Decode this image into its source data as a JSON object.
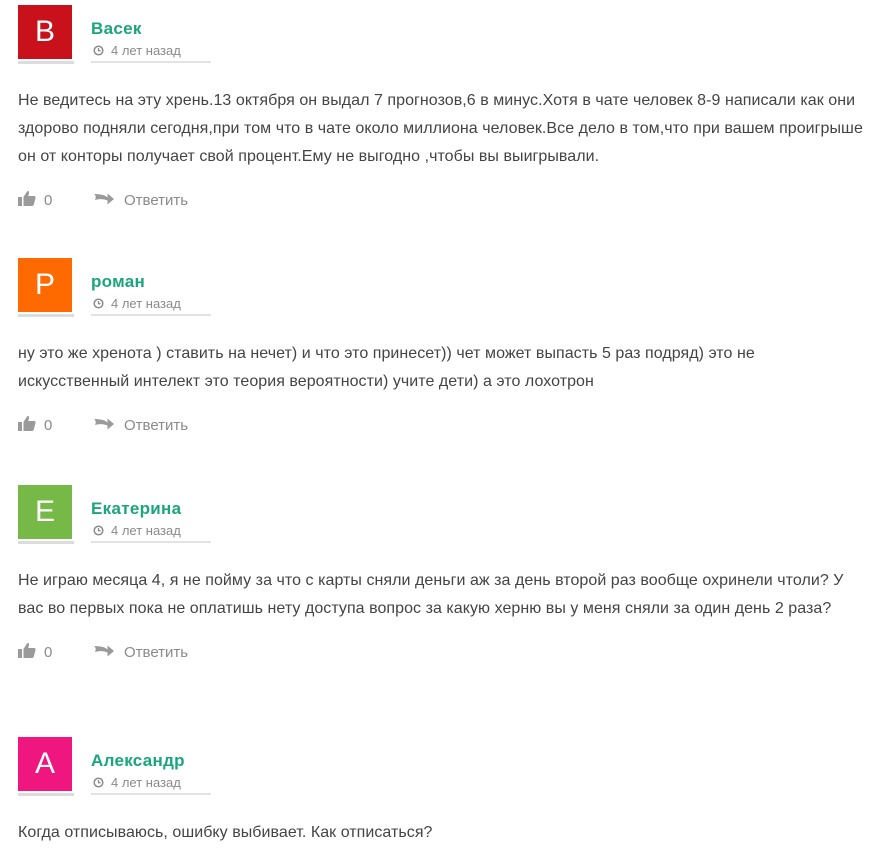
{
  "comments": [
    {
      "avatar_letter": "В",
      "avatar_color": "#c8111b",
      "author": "Васек",
      "time": "4 лет назад",
      "text": "Не ведитесь на эту хрень.13 октября он выдал 7 прогнозов,6 в минус.Хотя в чате человек 8-9 написали как они здорово подняли сегодня,при том что в чате около миллиона человек.Все дело в том,что при вашем проигрыше он от конторы получает свой процент.Ему не выгодно ,чтобы вы выигрывали.",
      "likes": "0",
      "reply_label": "Ответить"
    },
    {
      "avatar_letter": "Р",
      "avatar_color": "#ff6a00",
      "author": "роман",
      "time": "4 лет назад",
      "text": "ну это же хренота ) ставить на нечет) и что это принесет)) чет может выпасть 5 раз подряд) это не искусственный интелект это теория вероятности) учите дети) а это лохотрон",
      "likes": "0",
      "reply_label": "Ответить"
    },
    {
      "avatar_letter": "Е",
      "avatar_color": "#76b947",
      "author": "Екатерина",
      "time": "4 лет назад",
      "text": "Не играю месяца 4, я не пойму за что с карты сняли деньги аж за день второй раз вообще охринели чтоли? У вас во первых пока не оплатишь нету доступа вопрос за какую херню вы у меня сняли за один день 2 раза?",
      "likes": "0",
      "reply_label": "Ответить"
    },
    {
      "avatar_letter": "А",
      "avatar_color": "#f0167f",
      "author": "Александр",
      "time": "4 лет назад",
      "text": "Когда отписываюсь, ошибку выбивает. Как отписаться?"
    }
  ],
  "icons": {
    "clock": "clock-icon",
    "like": "thumbs-up-icon",
    "reply": "reply-arrow-icon"
  },
  "colors": {
    "author_name": "#1aa57f",
    "meta_text": "#8a8a8a",
    "body_text": "#444444"
  }
}
